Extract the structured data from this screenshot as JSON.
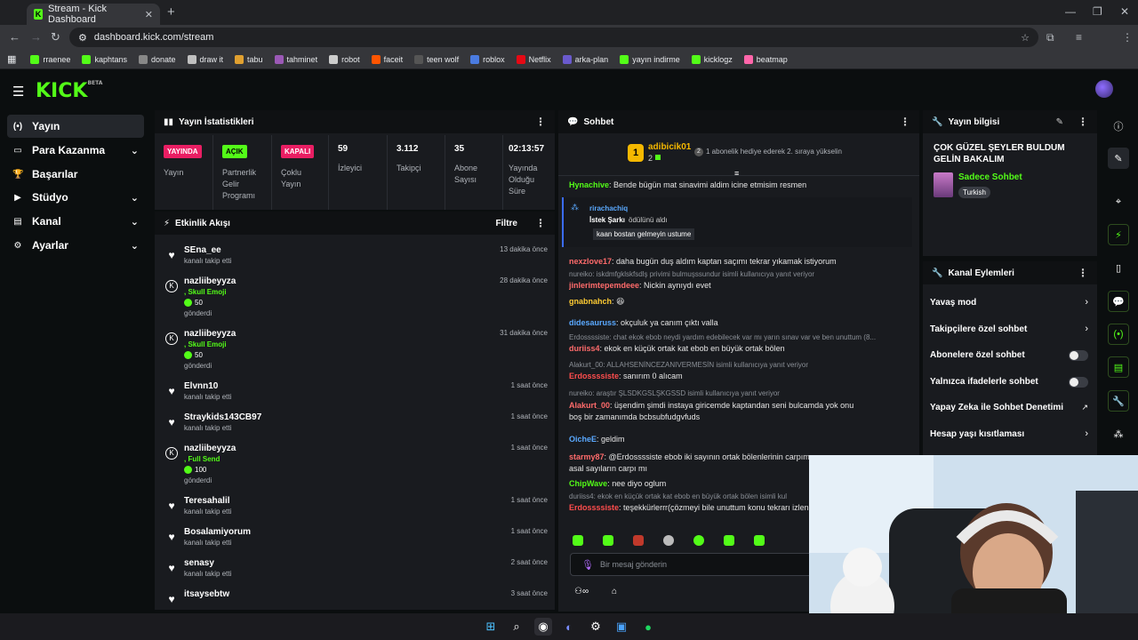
{
  "browser": {
    "tab_title": "Stream - Kick Dashboard",
    "url": "dashboard.kick.com/stream",
    "bookmarks": [
      {
        "label": "rraenee",
        "color": "#53fc18"
      },
      {
        "label": "kaphtans",
        "color": "#53fc18"
      },
      {
        "label": "donate",
        "color": "#888888"
      },
      {
        "label": "draw it",
        "color": "#c0c0c0"
      },
      {
        "label": "tabu",
        "color": "#e0a030"
      },
      {
        "label": "tahminet",
        "color": "#9b59b6"
      },
      {
        "label": "robot",
        "color": "#cccccc"
      },
      {
        "label": "faceit",
        "color": "#ff5500"
      },
      {
        "label": "teen wolf",
        "color": "#555555"
      },
      {
        "label": "roblox",
        "color": "#4a7be0"
      },
      {
        "label": "Netflix",
        "color": "#e50914"
      },
      {
        "label": "arka-plan",
        "color": "#6a5acd"
      },
      {
        "label": "yayın indirme",
        "color": "#53fc18"
      },
      {
        "label": "kicklogz",
        "color": "#53fc18"
      },
      {
        "label": "beatmap",
        "color": "#ff66aa"
      }
    ]
  },
  "brand": {
    "logo": "KICK",
    "beta": "BETA",
    "accent": "#53fc18"
  },
  "nav": [
    {
      "label": "Yayın",
      "icon": "broadcast-icon",
      "active": true,
      "chevron": false
    },
    {
      "label": "Para Kazanma",
      "icon": "money-icon",
      "active": false,
      "chevron": true
    },
    {
      "label": "Başarılar",
      "icon": "trophy-icon",
      "active": false,
      "chevron": false
    },
    {
      "label": "Stüdyo",
      "icon": "studio-icon",
      "active": false,
      "chevron": true
    },
    {
      "label": "Kanal",
      "icon": "channel-icon",
      "active": false,
      "chevron": true
    },
    {
      "label": "Ayarlar",
      "icon": "gear-icon",
      "active": false,
      "chevron": true
    }
  ],
  "stats": {
    "title": "Yayın İstatistikleri",
    "cells": [
      {
        "badge": "YAYINDA",
        "label": "Yayın"
      },
      {
        "badge": "AÇIK",
        "label": "Partnerlik Gelir Programı"
      },
      {
        "badge": "KAPALI",
        "label": "Çoklu Yayın"
      },
      {
        "value": "59",
        "label": "İzleyici"
      },
      {
        "value": "3.112",
        "label": "Takipçi"
      },
      {
        "value": "35",
        "label": "Abone Sayısı"
      },
      {
        "value": "02:13:57",
        "label": "Yayında Olduğu Süre"
      }
    ]
  },
  "activity": {
    "title": "Etkinlik Akışı",
    "filter": "Filtre",
    "items": [
      {
        "type": "follow",
        "name": "SEna_ee",
        "sub": "kanalı takip etti",
        "time": "13 dakika önce"
      },
      {
        "type": "kicks",
        "name": "nazliibeyyza",
        "item": ", Skull Emoji",
        "amount": "50",
        "sub": "gönderdi",
        "time": "28 dakika önce"
      },
      {
        "type": "kicks",
        "name": "nazliibeyyza",
        "item": ", Skull Emoji",
        "amount": "50",
        "sub": "gönderdi",
        "time": "31 dakika önce"
      },
      {
        "type": "follow",
        "name": "Elvnn10",
        "sub": "kanalı takip etti",
        "time": "1 saat önce"
      },
      {
        "type": "follow",
        "name": "Straykids143CB97",
        "sub": "kanalı takip etti",
        "time": "1 saat önce"
      },
      {
        "type": "kicks",
        "name": "nazliibeyyza",
        "item": ", Full Send",
        "amount": "100",
        "sub": "gönderdi",
        "time": "1 saat önce"
      },
      {
        "type": "follow",
        "name": "Teresahalil",
        "sub": "kanalı takip etti",
        "time": "1 saat önce"
      },
      {
        "type": "follow",
        "name": "Bosalamiyorum",
        "sub": "kanalı takip etti",
        "time": "1 saat önce"
      },
      {
        "type": "follow",
        "name": "senasy",
        "sub": "kanalı takip etti",
        "time": "2 saat önce"
      },
      {
        "type": "follow",
        "name": "itsaysebtw",
        "sub": "",
        "time": "3 saat önce"
      }
    ]
  },
  "chat": {
    "title": "Sohbet",
    "pinned": {
      "user": "adibicik01",
      "rank": "1",
      "count": "2",
      "text": "1 abonelik hediye ederek 2. sıraya yükselin"
    },
    "reward": {
      "user": "rirachachiq",
      "reward_label": "İstek Şarkı",
      "reward_text": "ödülünü aldı",
      "message": "kaan bostan gelmeyin ustume"
    },
    "messages": [
      {
        "kind": "msg",
        "user": "Hynachive",
        "color": "#53fc18",
        "text": "Bende bügün mat sinavimi aldim icine etmisim resmen"
      },
      {
        "kind": "msg",
        "user": "nexzlove17",
        "color": "#ff6b6b",
        "text": "daha bugün duş aldım kaptan saçımı tekrar yıkamak istiyorum"
      },
      {
        "kind": "reply",
        "text": "nureiko: iskdmfgklskfsdlş privimi bulmuşssundur isimli kullanıcıya yanıt veriyor"
      },
      {
        "kind": "msg",
        "user": "jinlerimtepemdeee",
        "color": "#ff6b6b",
        "text": "Nickin aynıydı evet"
      },
      {
        "kind": "msg",
        "user": "gnabnahch",
        "color": "#ffcc33",
        "text": "😆"
      },
      {
        "kind": "msg",
        "user": "didesauruss",
        "color": "#5aa9ff",
        "text": "okçuluk ya canım çıktı valla"
      },
      {
        "kind": "reply",
        "text": "Erdossssiste: chat ekok ebob neydi yardım edebilecek var mı yarın sınav var ve ben unuttum (8..."
      },
      {
        "kind": "msg",
        "user": "duriiss4",
        "color": "#ff6b6b",
        "text": "ekok en küçük ortak kat ebob en büyük ortak bölen"
      },
      {
        "kind": "reply",
        "text": "Alakurt_00: ALLAHSENİNCEZANIVERMESİN isimli kullanıcıya yanıt veriyor"
      },
      {
        "kind": "msg",
        "user": "Erdossssiste",
        "color": "#ff4d4d",
        "text": "sanırım 0 alıcam"
      },
      {
        "kind": "reply",
        "text": "nureiko: araştır ŞLSDKGSLŞKGSSD isimli kullanıcıya yanıt veriyor"
      },
      {
        "kind": "msg2",
        "user": "Alakurt_00",
        "color": "#ff6b6b",
        "text": "üşendim şimdi instaya giricemde kaptandan seni bulcamda yok onu",
        "cont": "boş bir zamanımda bcbsubfudgvfuds"
      },
      {
        "kind": "msg",
        "user": "OicheE",
        "color": "#5aa9ff",
        "text": "geldim"
      },
      {
        "kind": "msg2",
        "user": "starmy87",
        "color": "#ff6b6b",
        "text": "@Erdossssiste ebob iki sayının ortak bölenlerinin carpımı",
        "cont": "asal sayıların carpı mı"
      },
      {
        "kind": "msg",
        "user": "ChipWave",
        "color": "#53fc18",
        "text": "nee diyo oglum"
      },
      {
        "kind": "reply",
        "text": "duriiss4: ekok en küçük ortak kat ebob en büyük ortak bölen isimli kul"
      },
      {
        "kind": "msg",
        "user": "Erdossssiste",
        "color": "#ff4d4d",
        "text": "teşekkürlerrr(çözmeyi bile unuttum konu tekrarı izlen"
      }
    ],
    "input_placeholder": "Bir mesaj gönderin"
  },
  "info": {
    "title": "Yayın bilgisi",
    "stream_title": "ÇOK GÜZEL ŞEYLER BULDUM GELİN BAKALIM",
    "category": "Sadece Sohbet",
    "language": "Turkish"
  },
  "actions": {
    "title": "Kanal Eylemleri",
    "items": [
      {
        "label": "Yavaş mod",
        "control": "arrow"
      },
      {
        "label": "Takipçilere özel sohbet",
        "control": "arrow"
      },
      {
        "label": "Abonelere özel sohbet",
        "control": "toggle"
      },
      {
        "label": "Yalnızca ifadelerle sohbet",
        "control": "toggle"
      },
      {
        "label": "Yapay Zeka ile Sohbet Denetimi",
        "control": "external"
      },
      {
        "label": "Hesap yaşı kısıtlaması",
        "control": "arrow"
      }
    ]
  }
}
